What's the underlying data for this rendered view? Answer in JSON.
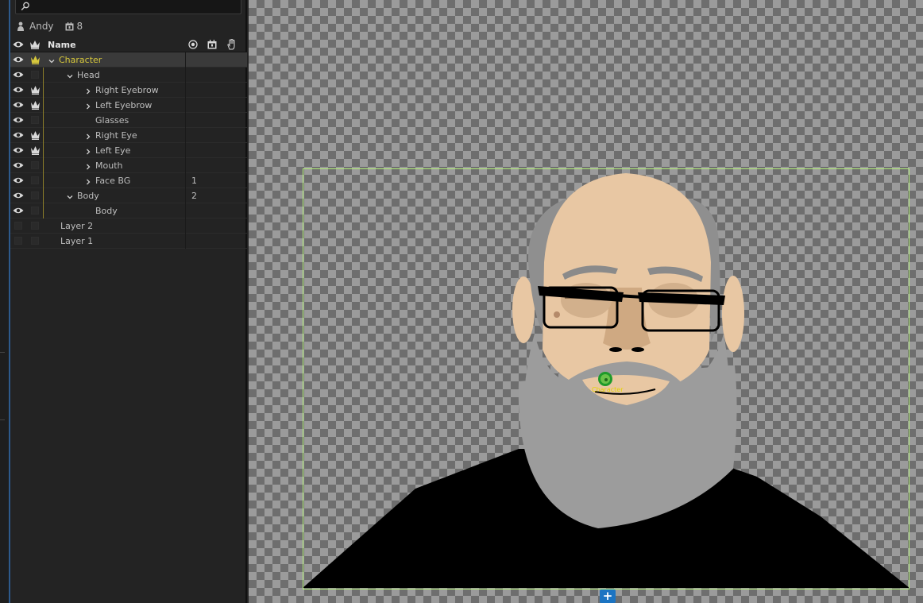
{
  "search": {
    "placeholder": ""
  },
  "info": {
    "username": "Andy",
    "count": "8"
  },
  "header": {
    "name_label": "Name"
  },
  "layers": [
    {
      "label": "Character",
      "num": "",
      "selected": true,
      "visible": true,
      "crown": true,
      "indent": 0,
      "chevron": "down"
    },
    {
      "label": "Head",
      "num": "",
      "selected": false,
      "visible": true,
      "crown": false,
      "indent": 1,
      "chevron": "down"
    },
    {
      "label": "Right Eyebrow",
      "num": "",
      "selected": false,
      "visible": true,
      "crown": true,
      "indent": 2,
      "chevron": "right"
    },
    {
      "label": "Left Eyebrow",
      "num": "",
      "selected": false,
      "visible": true,
      "crown": true,
      "indent": 2,
      "chevron": "right"
    },
    {
      "label": "Glasses",
      "num": "",
      "selected": false,
      "visible": true,
      "crown": false,
      "indent": 2,
      "chevron": "none"
    },
    {
      "label": "Right Eye",
      "num": "",
      "selected": false,
      "visible": true,
      "crown": true,
      "indent": 2,
      "chevron": "right"
    },
    {
      "label": "Left Eye",
      "num": "",
      "selected": false,
      "visible": true,
      "crown": true,
      "indent": 2,
      "chevron": "right"
    },
    {
      "label": "Mouth",
      "num": "",
      "selected": false,
      "visible": true,
      "crown": false,
      "indent": 2,
      "chevron": "right"
    },
    {
      "label": "Face BG",
      "num": "1",
      "selected": false,
      "visible": true,
      "crown": false,
      "indent": 2,
      "chevron": "right"
    },
    {
      "label": "Body",
      "num": "2",
      "selected": false,
      "visible": true,
      "crown": false,
      "indent": 1,
      "chevron": "down"
    },
    {
      "label": "Body",
      "num": "",
      "selected": false,
      "visible": true,
      "crown": false,
      "indent": 2,
      "chevron": "none"
    },
    {
      "label": "Layer 2",
      "num": "",
      "selected": false,
      "visible": false,
      "crown": false,
      "indent": 0,
      "chevron": "none"
    },
    {
      "label": "Layer 1",
      "num": "",
      "selected": false,
      "visible": false,
      "crown": false,
      "indent": 0,
      "chevron": "none"
    }
  ],
  "stage": {
    "origin_label": "Character",
    "add_label": "+"
  },
  "colors": {
    "accent": "#d7c83c",
    "frame": "#b4f07a",
    "selected_row": "#3a3a3a",
    "add_button": "#1c74c2"
  }
}
